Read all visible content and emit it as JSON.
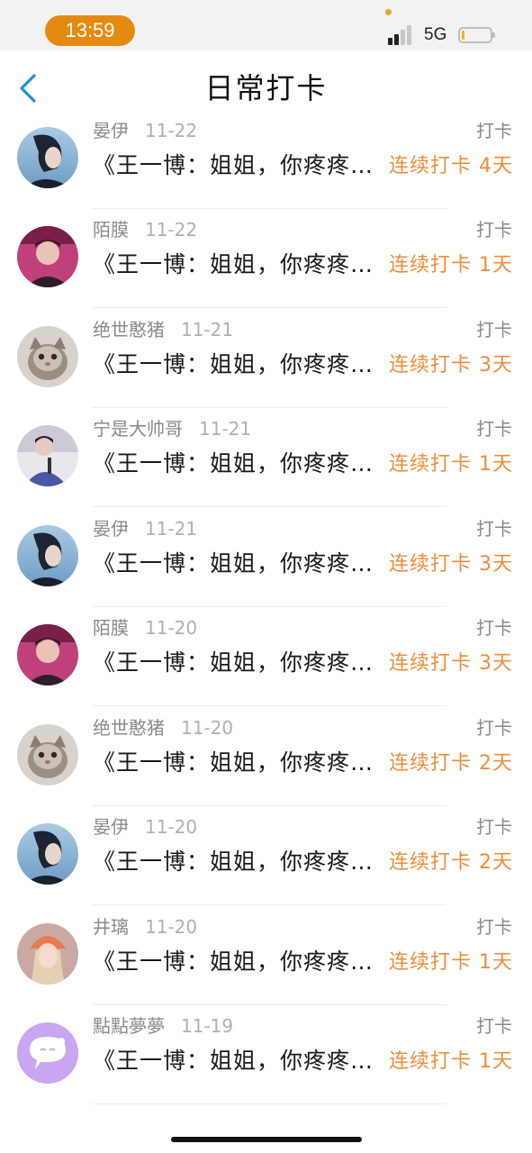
{
  "status_bar": {
    "time": "13:59",
    "network": "5G",
    "colors": {
      "time_pill": "#e58a10",
      "battery_level": "#f1b400"
    },
    "battery_level_fraction": 0.08
  },
  "header": {
    "back_icon": "chevron-left-icon",
    "title": "日常打卡",
    "colors": {
      "back_icon": "#1e90d6"
    }
  },
  "colors": {
    "streak": "#f08c3a",
    "meta": "#8a8a8a",
    "title": "#1a1a1a"
  },
  "entries": [
    {
      "user": "",
      "date": "",
      "type": "",
      "title": "《王一博：姐姐，你疼疼我吧》",
      "streak": "连续打卡 2天",
      "avatar": "dark-portrait"
    },
    {
      "user": "晏伊",
      "date": "11-22",
      "type": "打卡",
      "title": "《王一博：姐姐，你疼疼我吧》",
      "streak": "连续打卡 4天",
      "avatar": "blue-portrait"
    },
    {
      "user": "陌膜",
      "date": "11-22",
      "type": "打卡",
      "title": "《王一博：姐姐，你疼疼我吧》",
      "streak": "连续打卡 1天",
      "avatar": "pink-portrait"
    },
    {
      "user": "绝世憨猪",
      "date": "11-21",
      "type": "打卡",
      "title": "《王一博：姐姐，你疼疼我吧》",
      "streak": "连续打卡 3天",
      "avatar": "cat"
    },
    {
      "user": "宁是大帅哥",
      "date": "11-21",
      "type": "打卡",
      "title": "《王一博：姐姐，你疼疼我吧》",
      "streak": "连续打卡 1天",
      "avatar": "purple-portrait"
    },
    {
      "user": "晏伊",
      "date": "11-21",
      "type": "打卡",
      "title": "《王一博：姐姐，你疼疼我吧》",
      "streak": "连续打卡 3天",
      "avatar": "blue-portrait"
    },
    {
      "user": "陌膜",
      "date": "11-20",
      "type": "打卡",
      "title": "《王一博：姐姐，你疼疼我吧》",
      "streak": "连续打卡 3天",
      "avatar": "pink-portrait"
    },
    {
      "user": "绝世憨猪",
      "date": "11-20",
      "type": "打卡",
      "title": "《王一博：姐姐，你疼疼我吧》",
      "streak": "连续打卡 2天",
      "avatar": "cat"
    },
    {
      "user": "晏伊",
      "date": "11-20",
      "type": "打卡",
      "title": "《王一博：姐姐，你疼疼我吧》",
      "streak": "连续打卡 2天",
      "avatar": "blue-portrait"
    },
    {
      "user": "井璃",
      "date": "11-20",
      "type": "打卡",
      "title": "《王一博：姐姐，你疼疼我吧》",
      "streak": "连续打卡 1天",
      "avatar": "girl-orange-hat"
    },
    {
      "user": "點點夢夢",
      "date": "11-19",
      "type": "打卡",
      "title": "《王一博：姐姐，你疼疼我吧》",
      "streak": "连续打卡 1天",
      "avatar": "chat-bubble"
    }
  ]
}
